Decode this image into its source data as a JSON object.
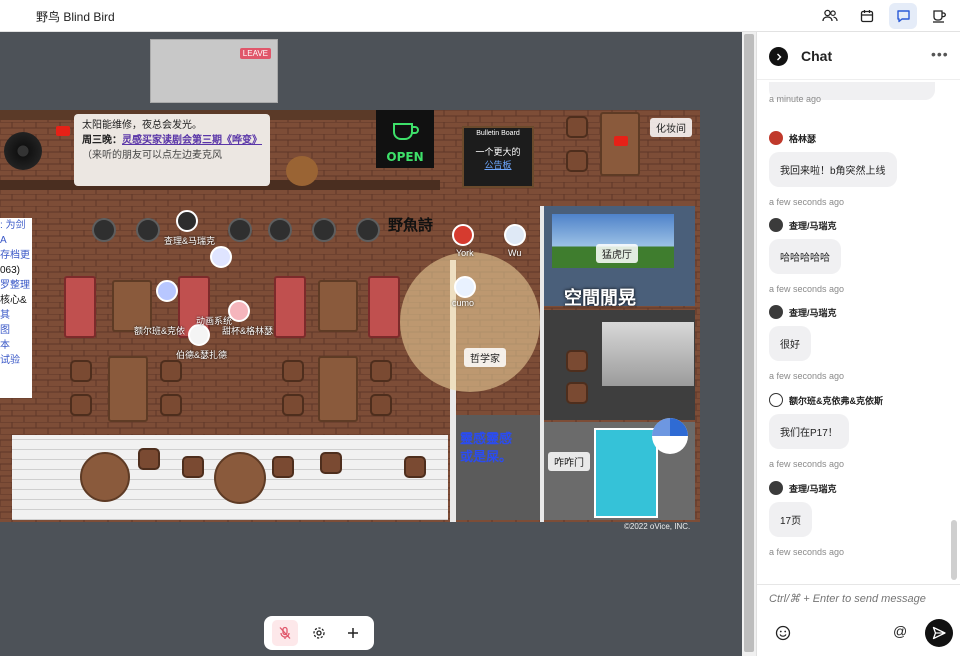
{
  "app": {
    "title": "野鸟 Blind Bird"
  },
  "topbar": {
    "icons": [
      "people-icon",
      "calendar-icon",
      "chat-icon",
      "coffee-icon"
    ],
    "active": "chat-icon"
  },
  "map": {
    "leave_label": "LEAVE",
    "notice": {
      "line1": "太阳能维修，夜总会发光。",
      "line2_prefix": "周三晚：",
      "line2_link": "灵感买家读剧会第三期《哗变》",
      "line3": "（来听的朋友可以点左边麦克风"
    },
    "bulletin": {
      "title": "Bulletin Board",
      "text": "一个更大的",
      "link": "公告板"
    },
    "open_sign": "OPEN",
    "fish_logo": "野魚詩",
    "rooms": {
      "makeup": "化妆间",
      "tiger": "猛虎厅",
      "philosopher": "哲学家",
      "zhazha": "咋咋门"
    },
    "space_label": "空間閒晃",
    "blue_text_1": "靈感靈感",
    "blue_text_2": "或是屎。",
    "left_list": [
      ": 为剑",
      "A",
      "存档更",
      "063)",
      "罗整理",
      "核心&",
      "其",
      "图",
      "本",
      "试验"
    ],
    "names": [
      "York",
      "Wu",
      "cumo",
      "查理&马瑞克",
      "伯德&瑟扎德",
      "额尔班&克依",
      "动画系统",
      "甜杯&格林瑟"
    ],
    "copyright": "©2022 oVice, INC."
  },
  "controls": {
    "icons": [
      "mic-muted-icon",
      "gear-icon",
      "plus-icon"
    ]
  },
  "chat": {
    "title": "Chat",
    "prev_time": "a minute ago",
    "messages": [
      {
        "sender": "格林瑟",
        "text": "我回来啦！b角突然上线",
        "time": "a few seconds ago",
        "avatar_color": "#c0392b"
      },
      {
        "sender": "查理/马瑞克",
        "text": "哈哈哈哈哈",
        "time": "a few seconds ago",
        "avatar_color": "#3b3b3b"
      },
      {
        "sender": "查理/马瑞克",
        "text": "很好",
        "time": "a few seconds ago",
        "avatar_color": "#3b3b3b"
      },
      {
        "sender": "额尔班&克依弗&克依斯",
        "text": "我们在P17！",
        "time": "a few seconds ago",
        "avatar_color": "#ffffff"
      },
      {
        "sender": "查理/马瑞克",
        "text": "17页",
        "time": "a few seconds ago",
        "avatar_color": "#3b3b3b"
      }
    ],
    "input_placeholder": "Ctrl/⌘ + Enter to send message"
  }
}
